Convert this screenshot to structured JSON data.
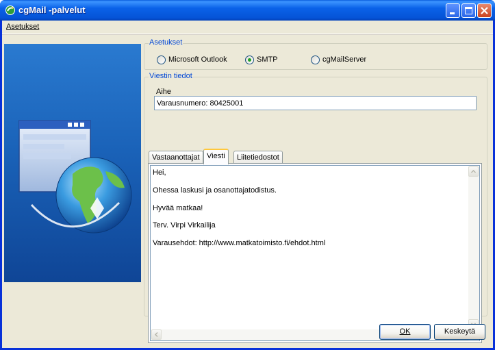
{
  "window": {
    "title": "cgMail -palvelut"
  },
  "menu": {
    "items": [
      {
        "label": "Asetukset"
      }
    ]
  },
  "settings": {
    "title": "Asetukset",
    "options": [
      {
        "label": "Microsoft Outlook",
        "selected": false
      },
      {
        "label": "SMTP",
        "selected": true
      },
      {
        "label": "cgMailServer",
        "selected": false
      }
    ]
  },
  "message": {
    "title": "Viestin tiedot",
    "subject_label": "Aihe",
    "subject_value": "Varausnumero: 80425001",
    "tabs": [
      {
        "label": "Vastaanottajat",
        "active": false
      },
      {
        "label": "Viesti",
        "active": true
      },
      {
        "label": "Liitetiedostot",
        "active": false
      }
    ],
    "body_lines": [
      "Hei,",
      "Ohessa laskusi ja osanottajatodistus.",
      "Hyvää matkaa!",
      "Terv. Virpi Virkailija",
      "Varausehdot: http://www.matkatoimisto.fi/ehdot.html"
    ]
  },
  "buttons": {
    "ok": "OK",
    "cancel": "Keskeytä"
  },
  "icons": {
    "title": "cgmail-app-icon",
    "banner": "window-globe-icon",
    "minimize": "minimize-icon",
    "maximize": "maximize-icon",
    "close": "close-icon"
  },
  "colors": {
    "accent": "#0046d5",
    "titlebar": "#0a62e8",
    "banner": "#1a62b8"
  }
}
